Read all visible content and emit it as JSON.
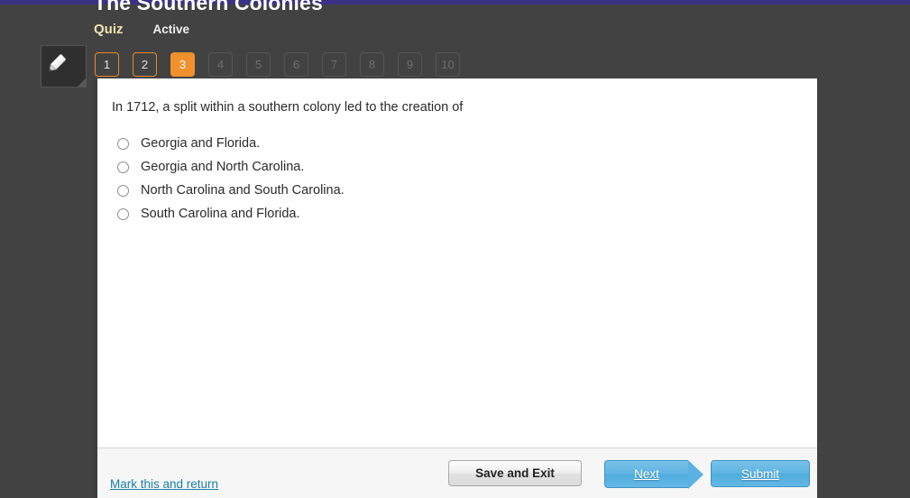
{
  "theme": {
    "accent_bar_color": "#3b3285",
    "page_background": "#424242",
    "pager_active_color": "#f1902d",
    "link_color": "#1a7fa8",
    "primary_button_color": "#5fb4e2"
  },
  "header": {
    "title": "The Southern Colonies",
    "quiz_label": "Quiz",
    "status_label": "Active"
  },
  "tools": {
    "pencil_icon": "pencil-icon"
  },
  "pager": {
    "items": [
      {
        "label": "1",
        "state": "visited"
      },
      {
        "label": "2",
        "state": "visited"
      },
      {
        "label": "3",
        "state": "current"
      },
      {
        "label": "4",
        "state": "locked"
      },
      {
        "label": "5",
        "state": "locked"
      },
      {
        "label": "6",
        "state": "locked"
      },
      {
        "label": "7",
        "state": "locked"
      },
      {
        "label": "8",
        "state": "locked"
      },
      {
        "label": "9",
        "state": "locked"
      },
      {
        "label": "10",
        "state": "locked"
      }
    ]
  },
  "question": {
    "text": "In 1712, a split within a southern colony led to the creation of",
    "options": [
      {
        "label": "Georgia and Florida.",
        "selected": false
      },
      {
        "label": "Georgia and North Carolina.",
        "selected": false
      },
      {
        "label": "North Carolina and South Carolina.",
        "selected": false
      },
      {
        "label": "South Carolina and Florida.",
        "selected": false
      }
    ]
  },
  "footer": {
    "mark_return_label": "Mark this and return",
    "save_exit_label": "Save and Exit",
    "next_label": "Next",
    "submit_label": "Submit"
  }
}
